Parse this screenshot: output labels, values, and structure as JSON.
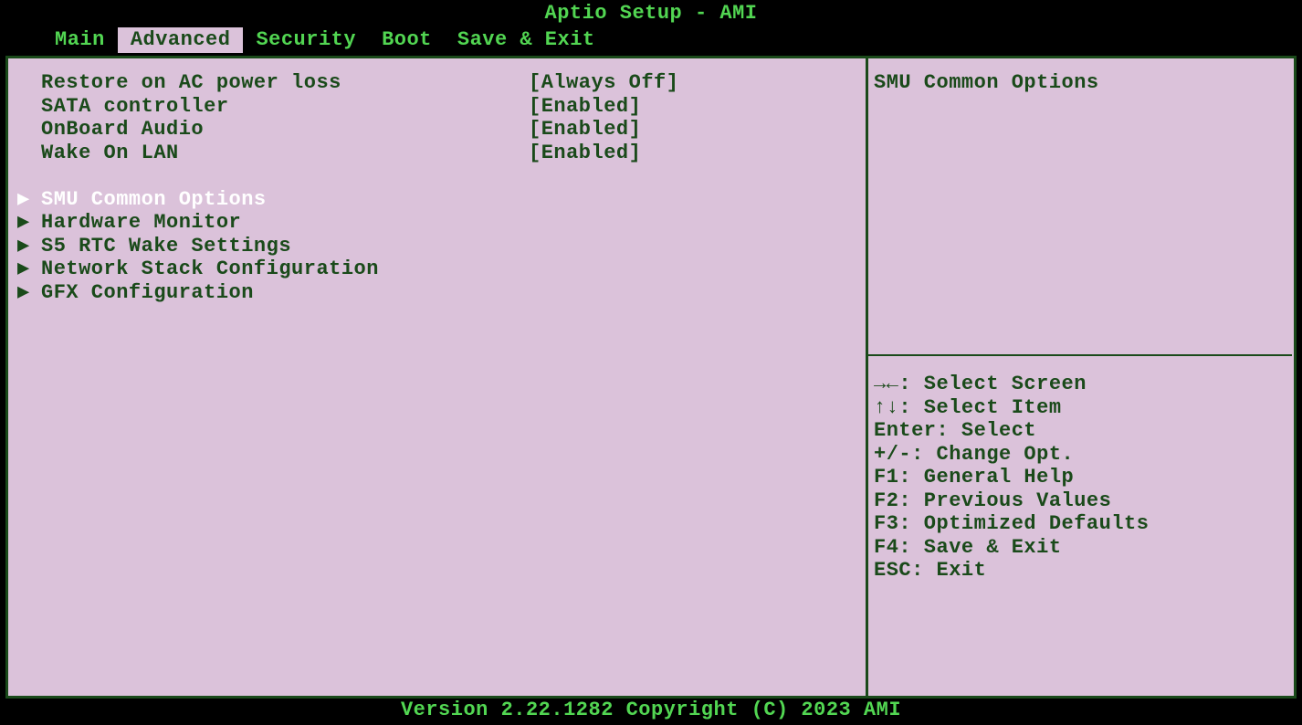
{
  "title": "Aptio Setup - AMI",
  "tabs": [
    {
      "label": "Main",
      "active": false
    },
    {
      "label": "Advanced",
      "active": true
    },
    {
      "label": "Security",
      "active": false
    },
    {
      "label": "Boot",
      "active": false
    },
    {
      "label": "Save & Exit",
      "active": false
    }
  ],
  "settings": [
    {
      "label": "Restore on AC power loss",
      "value": "[Always Off]"
    },
    {
      "label": "SATA controller",
      "value": "[Enabled]"
    },
    {
      "label": "OnBoard Audio",
      "value": "[Enabled]"
    },
    {
      "label": "Wake On LAN",
      "value": "[Enabled]"
    }
  ],
  "submenus": [
    {
      "label": "SMU Common Options",
      "selected": true
    },
    {
      "label": "Hardware Monitor",
      "selected": false
    },
    {
      "label": "S5 RTC Wake Settings",
      "selected": false
    },
    {
      "label": "Network Stack Configuration",
      "selected": false
    },
    {
      "label": "GFX Configuration",
      "selected": false
    }
  ],
  "help": {
    "title": "SMU Common Options",
    "keys": [
      "→←: Select Screen",
      "↑↓: Select Item",
      "Enter: Select",
      "+/-: Change Opt.",
      "F1: General Help",
      "F2: Previous Values",
      "F3: Optimized Defaults",
      "F4: Save & Exit",
      "ESC: Exit"
    ]
  },
  "footer": "Version 2.22.1282 Copyright (C) 2023 AMI"
}
